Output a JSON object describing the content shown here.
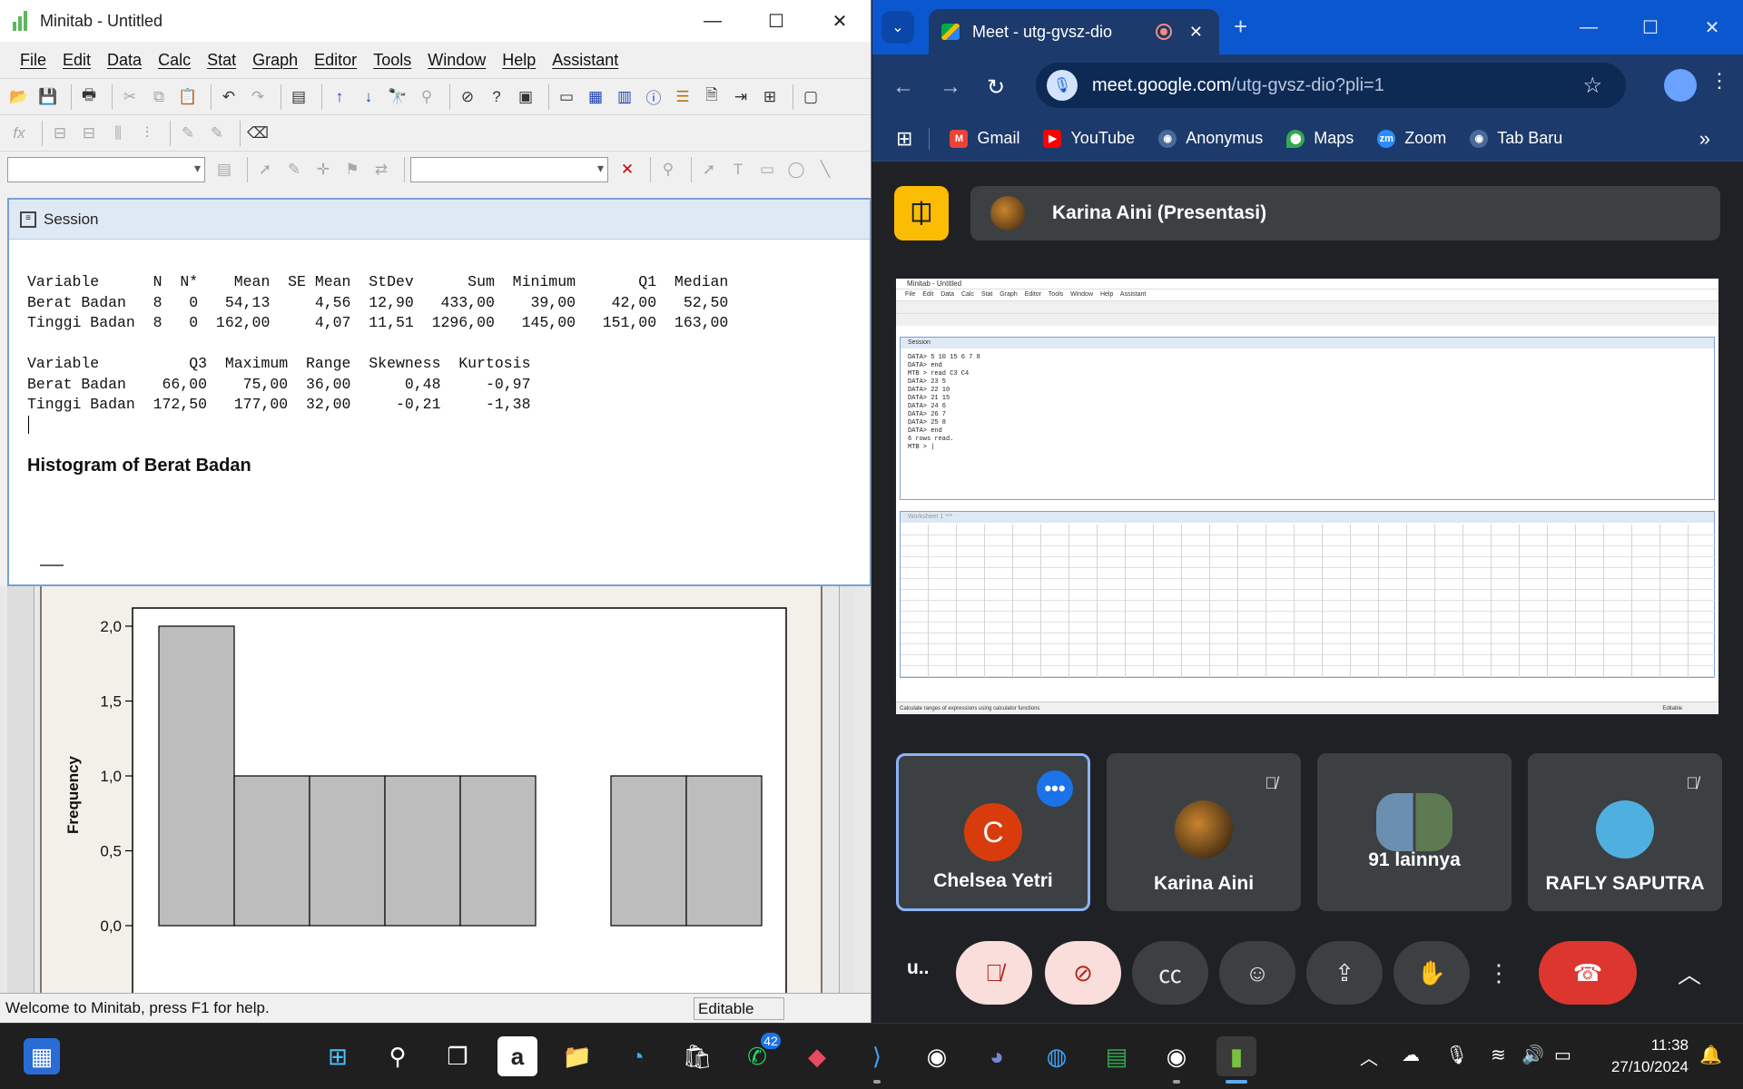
{
  "minitab": {
    "title": "Minitab - Untitled",
    "menu": [
      "File",
      "Edit",
      "Data",
      "Calc",
      "Stat",
      "Graph",
      "Editor",
      "Tools",
      "Window",
      "Help",
      "Assistant"
    ],
    "session": {
      "title": "Session",
      "table1_header": "Variable      N  N*    Mean  SE Mean  StDev      Sum  Minimum       Q1  Median",
      "table1_row1": "Berat Badan   8   0   54,13     4,56  12,90   433,00    39,00    42,00   52,50",
      "table1_row2": "Tinggi Badan  8   0  162,00     4,07  11,51  1296,00   145,00   151,00  163,00",
      "table2_header": "Variable          Q3  Maximum  Range  Skewness  Kurtosis",
      "table2_row1": "Berat Badan    66,00    75,00  36,00      0,48     -0,97",
      "table2_row2": "Tinggi Badan  172,50   177,00  32,00     -0,21     -1,38",
      "histogram_title": "Histogram of Berat Badan"
    },
    "status": "Welcome to Minitab, press F1 for help.",
    "status_mode": "Editable"
  },
  "chart_data": {
    "type": "bar",
    "title": "",
    "xlabel": "",
    "ylabel": "Frequency",
    "ylim": [
      0,
      2.0
    ],
    "yticks": [
      "0,0",
      "0,5",
      "1,0",
      "1,5",
      "2,0"
    ],
    "values": [
      2,
      1,
      1,
      1,
      1,
      0,
      1,
      1
    ]
  },
  "chrome": {
    "tab_title": "Meet - utg-gvsz-dio",
    "url_host": "meet.google.com",
    "url_path": "/utg-gvsz-dio?pli=1",
    "bookmarks": [
      {
        "label": "Gmail",
        "color": "#ea4335",
        "glyph": "M"
      },
      {
        "label": "YouTube",
        "color": "#ff0000",
        "glyph": "▶"
      },
      {
        "label": "Anonymus",
        "color": "#4a6a9a",
        "glyph": "◉"
      },
      {
        "label": "Maps",
        "color": "#34a853",
        "glyph": "⬤"
      },
      {
        "label": "Zoom",
        "color": "#2d8cff",
        "glyph": "zm"
      },
      {
        "label": "Tab Baru",
        "color": "#4a6a9a",
        "glyph": "◉"
      }
    ]
  },
  "meet": {
    "presenter_label": "Karina Aini (Presentasi)",
    "tiles": [
      {
        "name": "Chelsea Yetri",
        "initial": "C"
      },
      {
        "name": "Karina Aini"
      },
      {
        "name": "91 lainnya"
      },
      {
        "name": "RAFLY SAPUTRA"
      }
    ],
    "self_label": "u.."
  },
  "shared_screen": {
    "title": "Minitab - Untitled",
    "menu": "File Edit Data Calc Stat Graph Editor Tools Window Help Assistant",
    "session_title": "Session",
    "session_text": "DATA> 5 10 15 6 7 8\nDATA> end\nMTB > read C3 C4\nDATA> 23 5\nDATA> 22 10\nDATA> 21 15\nDATA> 24 6\nDATA> 26 7\nDATA> 25 8\nDATA> end\n6 rows read.\nMTB > |",
    "worksheet_title": "Worksheet 1 ***",
    "status": "Calculate ranges of expressions using calculator functions",
    "status_mode": "Editable"
  },
  "taskbar": {
    "whatsapp_badge": "42",
    "time": "11:38",
    "date": "27/10/2024"
  }
}
